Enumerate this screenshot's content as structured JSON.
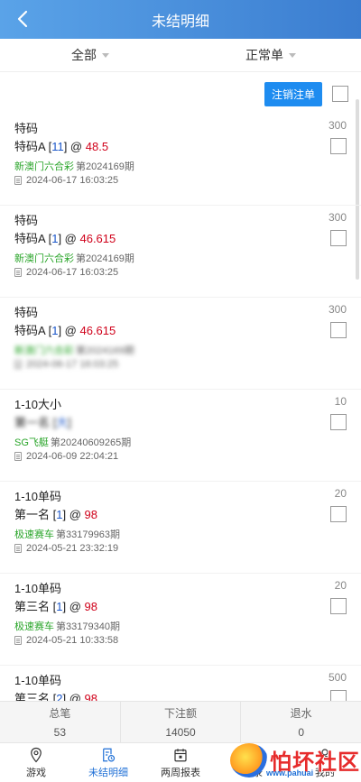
{
  "header": {
    "title": "未结明细",
    "back_icon": "chevron-left-icon"
  },
  "filters": [
    {
      "label": "全部"
    },
    {
      "label": "正常单"
    }
  ],
  "actions": {
    "cancel_label": "注销注单"
  },
  "bets": [
    {
      "category": "特码",
      "amount": "300",
      "bet_name": "特码A",
      "bet_num": "11",
      "odds": "48.5",
      "lottery": "新澳门六合彩",
      "period": "第2024169期",
      "time": "2024-06-17 16:03:25"
    },
    {
      "category": "特码",
      "amount": "300",
      "bet_name": "特码A",
      "bet_num": "1",
      "odds": "46.615",
      "lottery": "新澳门六合彩",
      "period": "第2024169期",
      "time": "2024-06-17 16:03:25"
    },
    {
      "category": "特码",
      "amount": "300",
      "bet_name": "特码A",
      "bet_num": "1",
      "odds": "46.615",
      "lottery": "新澳门六合彩",
      "period": "第2024169期",
      "time": "2024-06-17 16:03:25"
    },
    {
      "category": "1-10大小",
      "amount": "10",
      "bet_name": "第一名",
      "bet_num": "大",
      "odds": "",
      "lottery": "SG飞艇",
      "period": "第20240609265期",
      "time": "2024-06-09 22:04:21"
    },
    {
      "category": "1-10单码",
      "amount": "20",
      "bet_name": "第一名",
      "bet_num": "1",
      "odds": "98",
      "lottery": "极速赛车",
      "period": "第33179963期",
      "time": "2024-05-21 23:32:19"
    },
    {
      "category": "1-10单码",
      "amount": "20",
      "bet_name": "第三名",
      "bet_num": "1",
      "odds": "98",
      "lottery": "极速赛车",
      "period": "第33179340期",
      "time": "2024-05-21 10:33:58"
    },
    {
      "category": "1-10单码",
      "amount": "500",
      "bet_name": "第三名",
      "bet_num": "2",
      "odds": "98",
      "lottery": "",
      "period": "",
      "time": ""
    }
  ],
  "summary": {
    "total_label": "总笔",
    "total_value": "53",
    "stake_label": "下注额",
    "stake_value": "14050",
    "rebate_label": "退水",
    "rebate_value": "0"
  },
  "tabs": [
    {
      "label": "游戏",
      "icon": "location-pin-icon"
    },
    {
      "label": "未结明细",
      "icon": "receipt-clock-icon"
    },
    {
      "label": "两周报表",
      "icon": "calendar-icon"
    },
    {
      "label": "记录",
      "icon": "list-icon"
    },
    {
      "label": "我的",
      "icon": "user-icon"
    }
  ],
  "watermark": {
    "text": "怕坏社区",
    "url": "www.pahuai"
  }
}
